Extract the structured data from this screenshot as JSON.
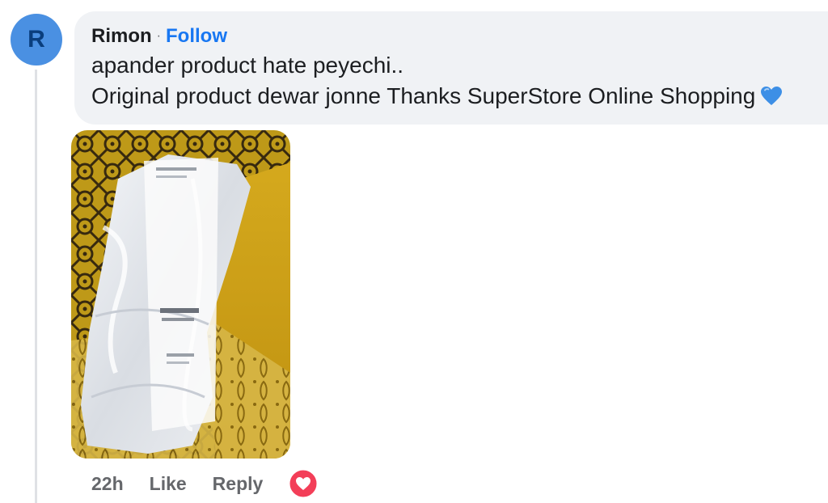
{
  "comment": {
    "avatar_letter": "R",
    "author": "Rimon",
    "separator": "·",
    "follow_label": "Follow",
    "lines": [
      "apander product hate peyechi..",
      "Original product dewar jonne Thanks SuperStore Online Shopping"
    ],
    "emoji_icon": "blue-heart-icon"
  },
  "actions": {
    "time": "22h",
    "like_label": "Like",
    "reply_label": "Reply",
    "reaction_icon": "love-reaction-icon"
  },
  "colors": {
    "avatar_bg": "#4a90e2",
    "follow_link": "#1877f2",
    "bubble_bg": "#f0f2f5",
    "love_reaction": "#f33e58",
    "blue_heart": "#3d8fe6"
  }
}
